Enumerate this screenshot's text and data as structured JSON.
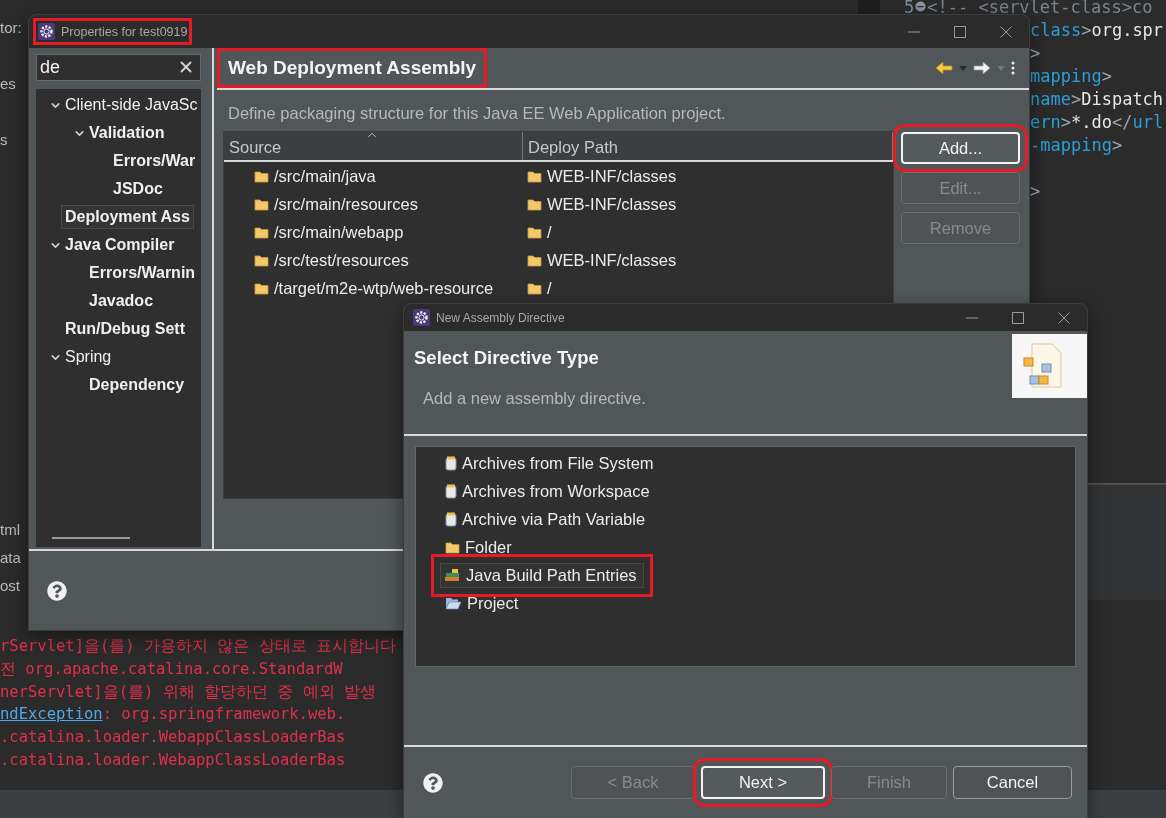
{
  "background": {
    "left_panel_top": [
      "tor:",
      "es",
      "s"
    ],
    "left_panel_bottom": [
      "tml",
      "ata",
      "ost"
    ],
    "editor": {
      "top_line": {
        "number": "5",
        "segments": [
          {
            "text": "<!-- <servlet-class>co",
            "kind": "comment"
          }
        ]
      },
      "lines": [
        {
          "segments": [
            {
              "text": "class",
              "kind": "tag"
            },
            {
              "text": ">",
              "kind": "punct"
            },
            {
              "text": "org.spr",
              "kind": "text"
            }
          ]
        },
        {
          "segments": [
            {
              "text": ">",
              "kind": "punct"
            }
          ]
        },
        {
          "segments": [
            {
              "text": "mapping",
              "kind": "tag"
            },
            {
              "text": ">",
              "kind": "punct"
            }
          ]
        },
        {
          "segments": [
            {
              "text": "name",
              "kind": "tag"
            },
            {
              "text": ">",
              "kind": "punct"
            },
            {
              "text": "Dispatch",
              "kind": "text"
            }
          ]
        },
        {
          "segments": [
            {
              "text": "ern",
              "kind": "tag"
            },
            {
              "text": ">",
              "kind": "punct"
            },
            {
              "text": "*.do",
              "kind": "text"
            },
            {
              "text": "</",
              "kind": "punct"
            },
            {
              "text": "url",
              "kind": "tag"
            }
          ]
        },
        {
          "segments": [
            {
              "text": "-mapping",
              "kind": "tag"
            },
            {
              "text": ">",
              "kind": "punct"
            }
          ]
        },
        {
          "segments": [
            {
              "text": ">",
              "kind": "punct"
            }
          ]
        }
      ]
    },
    "console": {
      "lines": [
        {
          "segments": [
            {
              "text": "rServlet]을(를) 가용하지 않은 상태로 표시합니다",
              "kind": "text"
            }
          ]
        },
        {
          "segments": [
            {
              "text": "전 org.apache.catalina.core.StandardW",
              "kind": "text"
            }
          ]
        },
        {
          "segments": [
            {
              "text": "nerServlet]을(를) 위해 할당하던 중 예외 발생",
              "kind": "text"
            }
          ]
        },
        {
          "segments": [
            {
              "text": "ndException",
              "kind": "link"
            },
            {
              "text": ": org.springframework.web.",
              "kind": "text"
            }
          ]
        },
        {
          "segments": [
            {
              "text": ".catalina.loader.WebappClassLoaderBas",
              "kind": "text"
            }
          ]
        },
        {
          "segments": [
            {
              "text": ".catalina.loader.WebappClassLoaderBas",
              "kind": "text"
            }
          ]
        }
      ]
    }
  },
  "properties_window": {
    "title": "Properties for test0919",
    "title_highlighted": true,
    "search": {
      "value": "de"
    },
    "tree": [
      {
        "label": "Client-side JavaSc",
        "matched": false,
        "selected": false,
        "expanded": true,
        "children": [
          {
            "label": "Validation",
            "matched": true,
            "selected": false,
            "expanded": true,
            "children": [
              {
                "label": "Errors/War",
                "matched": true,
                "selected": false
              },
              {
                "label": "JSDoc",
                "matched": true,
                "selected": false
              }
            ]
          }
        ]
      },
      {
        "label": "Deployment Ass",
        "matched": true,
        "selected": true
      },
      {
        "label": "Java Compiler",
        "matched": true,
        "selected": false,
        "expanded": true,
        "children": [
          {
            "label": "Errors/Warnin",
            "matched": true,
            "selected": false
          },
          {
            "label": "Javadoc",
            "matched": true,
            "selected": false
          }
        ]
      },
      {
        "label": "Run/Debug Sett",
        "matched": true,
        "selected": false
      },
      {
        "label": "Spring",
        "matched": false,
        "selected": false,
        "expanded": true,
        "children": [
          {
            "label": "Dependency",
            "matched": true,
            "selected": false
          }
        ]
      }
    ],
    "page": {
      "title": "Web Deployment Assembly",
      "title_highlighted": true,
      "description": "Define packaging structure for this Java EE Web Application project.",
      "table": {
        "columns": [
          "Source",
          "Deploy Path"
        ],
        "rows": [
          {
            "source": "/src/main/java",
            "deploy_path": "WEB-INF/classes"
          },
          {
            "source": "/src/main/resources",
            "deploy_path": "WEB-INF/classes"
          },
          {
            "source": "/src/main/webapp",
            "deploy_path": "/"
          },
          {
            "source": "/src/test/resources",
            "deploy_path": "WEB-INF/classes"
          },
          {
            "source": "/target/m2e-wtp/web-resource",
            "deploy_path": "/"
          }
        ]
      },
      "buttons": [
        {
          "label": "Add...",
          "disabled": false,
          "highlighted": true
        },
        {
          "label": "Edit...",
          "disabled": true,
          "highlighted": false
        },
        {
          "label": "Remove",
          "disabled": true,
          "highlighted": false
        }
      ]
    }
  },
  "directive_dialog": {
    "title": "New Assembly Directive",
    "heading": "Select Directive Type",
    "description": "Add a new assembly directive.",
    "items": [
      {
        "label": "Archives from File System",
        "kind": "archive",
        "selected": false,
        "highlighted": false
      },
      {
        "label": "Archives from Workspace",
        "kind": "archive",
        "selected": false,
        "highlighted": false
      },
      {
        "label": "Archive via Path Variable",
        "kind": "archive",
        "selected": false,
        "highlighted": false
      },
      {
        "label": "Folder",
        "kind": "folder",
        "selected": false,
        "highlighted": false
      },
      {
        "label": "Java Build Path Entries",
        "kind": "build_path",
        "selected": true,
        "highlighted": true
      },
      {
        "label": "Project",
        "kind": "project",
        "selected": false,
        "highlighted": false
      }
    ],
    "buttons": [
      {
        "label": "< Back",
        "disabled": true,
        "highlighted": false
      },
      {
        "label": "Next >",
        "disabled": false,
        "highlighted": true
      },
      {
        "label": "Finish",
        "disabled": true,
        "highlighted": false
      },
      {
        "label": "Cancel",
        "disabled": false,
        "highlighted": false
      }
    ]
  }
}
